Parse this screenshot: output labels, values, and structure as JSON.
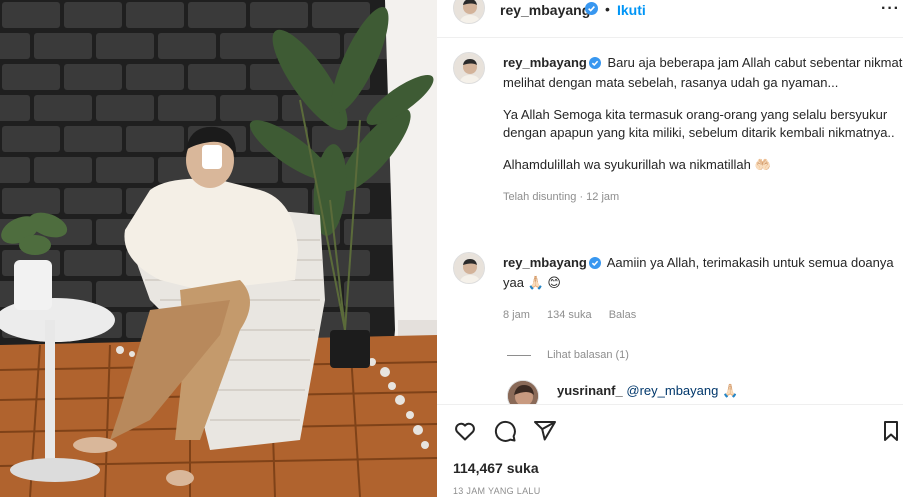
{
  "post": {
    "username": "rey_mbayang",
    "dot": "•",
    "follow_label": "Ikuti",
    "more_label": "···",
    "icons": {
      "verified": "verified-badge-icon",
      "more": "more-options-icon"
    }
  },
  "caption": {
    "username": "rey_mbayang",
    "line1": "Baru aja beberapa jam Allah cabut sebentar nikmat melihat dengan mata sebelah, rasanya udah ga nyaman...",
    "line2": "Ya Allah Semoga kita termasuk orang-orang yang selalu bersyukur dengan apapun yang kita miliki, sebelum ditarik kembali nikmatnya..",
    "line3": "Alhamdulillah wa syukurillah wa nikmatillah 🤲🏻",
    "meta_edited": "Telah disunting · 12 jam"
  },
  "comment": {
    "username": "rey_mbayang",
    "text": "Aamiin ya Allah, terimakasih untuk semua doanya yaa 🙏🏻 😊",
    "time": "8 jam",
    "likes": "134 suka",
    "reply_label": "Balas",
    "view_replies": "Lihat balasan (1)"
  },
  "reply": {
    "username": "yusrinanf_",
    "mention": "@rey_mbayang",
    "emoji": "🙏🏻"
  },
  "actions": {
    "icons": [
      "heart-icon",
      "comment-icon",
      "share-icon",
      "bookmark-icon"
    ]
  },
  "likes": "114,467 suka",
  "timestamp": "13 JAM YANG LALU",
  "colors": {
    "accent": "#0095f6",
    "text": "#262626",
    "muted": "#8e8e8e",
    "verified": "#3897f0"
  }
}
